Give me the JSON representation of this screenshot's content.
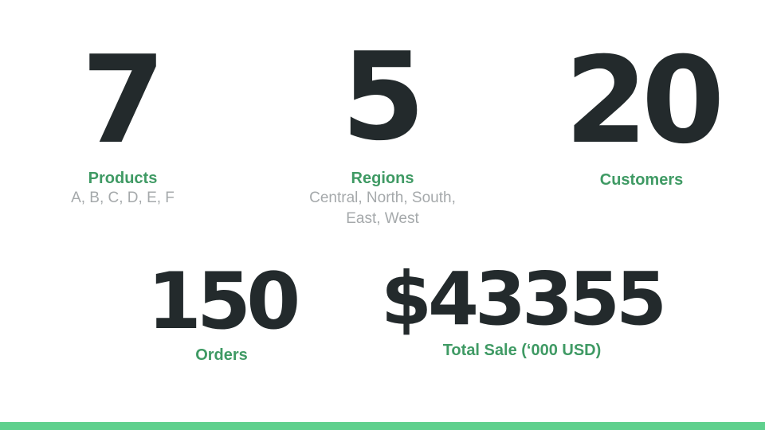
{
  "colors": {
    "number": "#232a2c",
    "label": "#3f9a64",
    "description": "#a5a9ab",
    "accent_bar": "#5fd08d"
  },
  "stats": {
    "products": {
      "value": "7",
      "label": "Products",
      "description": "A, B, C, D, E, F"
    },
    "regions": {
      "value": "5",
      "label": "Regions",
      "description_line1": "Central, North, South,",
      "description_line2": "East, West"
    },
    "customers": {
      "value": "20",
      "label": "Customers"
    },
    "orders": {
      "value": "150",
      "label": "Orders"
    },
    "total_sale": {
      "value": "$43355",
      "label": "Total Sale (‘000 USD)"
    }
  }
}
